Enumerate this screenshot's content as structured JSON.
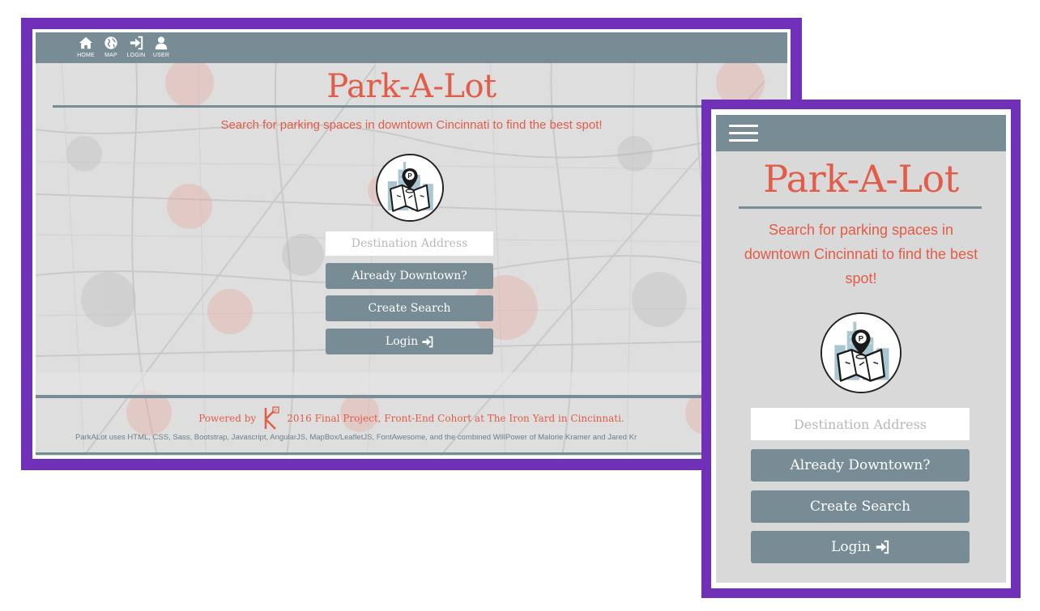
{
  "brand": {
    "title": "Park-A-Lot",
    "tagline": "Search for parking spaces in downtown Cincinnati to find the best spot!"
  },
  "colors": {
    "accent": "#e25c47",
    "nav": "#778c95",
    "frame": "#7030b8"
  },
  "desktop_nav": {
    "items": [
      {
        "label": "HOME",
        "icon": "home-icon"
      },
      {
        "label": "MAP",
        "icon": "globe-icon"
      },
      {
        "label": "LOGIN",
        "icon": "sign-in-icon"
      },
      {
        "label": "USER",
        "icon": "user-icon"
      }
    ]
  },
  "form": {
    "destination_placeholder": "Destination Address",
    "already_downtown_label": "Already Downtown?",
    "create_search_label": "Create Search",
    "login_label": "Login"
  },
  "footer": {
    "powered_by": "Powered by",
    "project_text": "2016 Final Project, Front-End Cohort at The Iron Yard in Cincinnati.",
    "credits": "ParkALot uses HTML, CSS, Sass, Bootstrap, Javascript, AngularJS, MapBox/LeafletJS, FontAwesome, and the combined WillPower of Malorie Kramer and Jared Kr"
  },
  "mobile_nav": {
    "menu_icon": "hamburger-menu-icon"
  }
}
